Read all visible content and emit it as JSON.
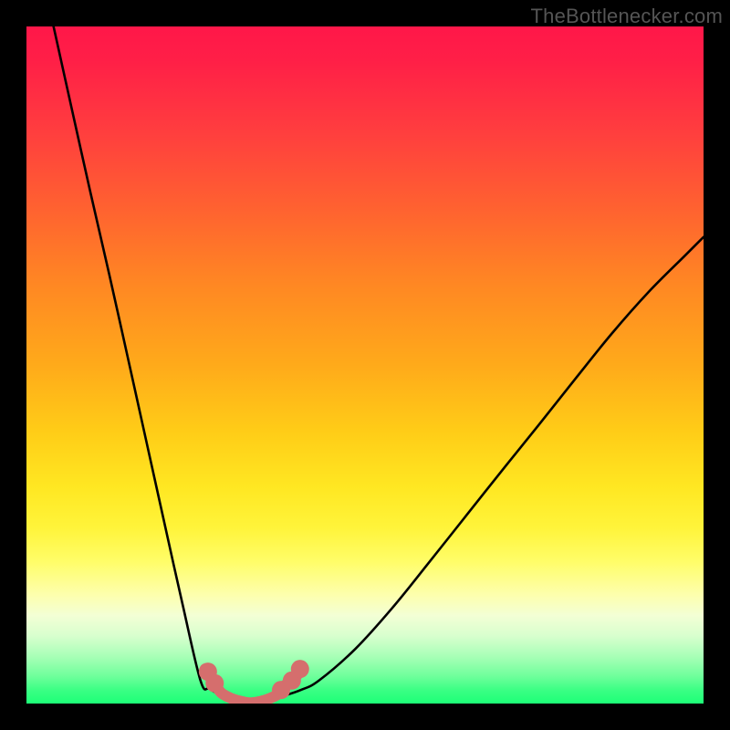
{
  "watermark": {
    "text": "TheBottlenecker.com"
  },
  "chart_data": {
    "type": "line",
    "title": "",
    "xlabel": "",
    "ylabel": "",
    "xlim": [
      0,
      100
    ],
    "ylim": [
      0,
      100
    ],
    "series": [
      {
        "name": "left-curve",
        "x": [
          4.0,
          6.7,
          9.4,
          12.2,
          14.9,
          17.6,
          20.3,
          23.0,
          25.7,
          27.0,
          28.4,
          29.7,
          31.1,
          32.4
        ],
        "y": [
          100.0,
          87.8,
          75.7,
          63.5,
          51.4,
          39.2,
          27.0,
          14.9,
          3.4,
          2.2,
          1.4,
          0.7,
          0.3,
          0.0
        ]
      },
      {
        "name": "right-curve",
        "x": [
          32.4,
          35.1,
          37.8,
          40.5,
          43.2,
          48.6,
          54.1,
          59.5,
          64.9,
          70.3,
          75.7,
          81.1,
          86.5,
          91.9,
          97.3,
          100.0
        ],
        "y": [
          0.0,
          0.4,
          1.1,
          2.0,
          3.4,
          8.1,
          14.2,
          20.9,
          27.7,
          34.5,
          41.2,
          48.0,
          54.7,
          60.8,
          66.2,
          68.9
        ]
      },
      {
        "name": "marker-track",
        "color": "#d56e6d",
        "x": [
          26.4,
          27.0,
          27.7,
          28.4,
          29.0,
          30.4,
          31.8,
          33.1,
          34.5,
          35.8,
          37.2,
          37.8,
          38.5,
          39.9,
          40.5
        ],
        "y": [
          5.1,
          4.1,
          3.0,
          2.0,
          1.4,
          0.7,
          0.3,
          0.1,
          0.3,
          0.7,
          1.4,
          2.0,
          3.0,
          4.1,
          5.1
        ]
      }
    ],
    "markers": {
      "name": "dots",
      "color": "#d56e6d",
      "radius_px": 10,
      "points": [
        {
          "x": 26.8,
          "y": 4.7
        },
        {
          "x": 27.8,
          "y": 3.0
        },
        {
          "x": 37.6,
          "y": 2.0
        },
        {
          "x": 39.2,
          "y": 3.4
        },
        {
          "x": 40.4,
          "y": 5.1
        }
      ]
    }
  }
}
